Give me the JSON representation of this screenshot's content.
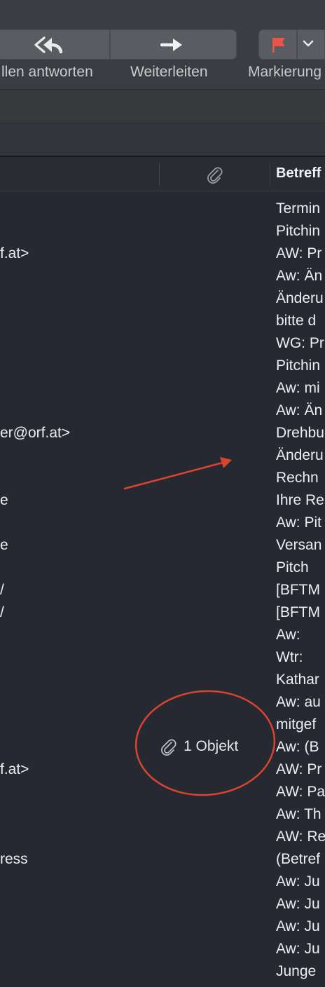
{
  "toolbar": {
    "reply_all_label": "llen antworten",
    "forward_label": "Weiterleiten",
    "flag_label": "Markierung",
    "reply_all_icon": "reply-all-icon",
    "forward_icon": "forward-arrow-icon",
    "flag_icon": "flag-icon",
    "flag_color": "#e8564a"
  },
  "column_header": {
    "attachment_icon": "paperclip-icon",
    "subject_label": "Betreff"
  },
  "senders": [
    "f.at>",
    "er@orf.at>",
    "e",
    "e",
    "/",
    "/",
    "f.at>",
    "ress"
  ],
  "subjects": [
    "Termin",
    "Pitchin",
    "AW: Pr",
    "Aw: Än",
    "Änderu",
    "bitte d",
    "WG: Pr",
    "Pitchin",
    "Aw: mi",
    "Aw: Än",
    "Drehbu",
    "Änderu",
    "Rechn",
    "Ihre Re",
    "Aw: Pit",
    "Versan",
    "Pitch",
    "[BFTM",
    "[BFTM",
    "Aw:",
    "Wtr:",
    "Kathar",
    "Aw: au",
    "mitgef",
    "Aw: (B",
    "AW: Pr",
    "AW: Pa",
    "Aw: Th",
    "AW: Re",
    "(Betref",
    "Aw: Ju",
    "Aw: Ju",
    "Aw: Ju",
    "Aw: Ju",
    "Junge"
  ],
  "annotation": {
    "attachment_count": "1 Objekt",
    "annotation_color": "#d9442e"
  }
}
